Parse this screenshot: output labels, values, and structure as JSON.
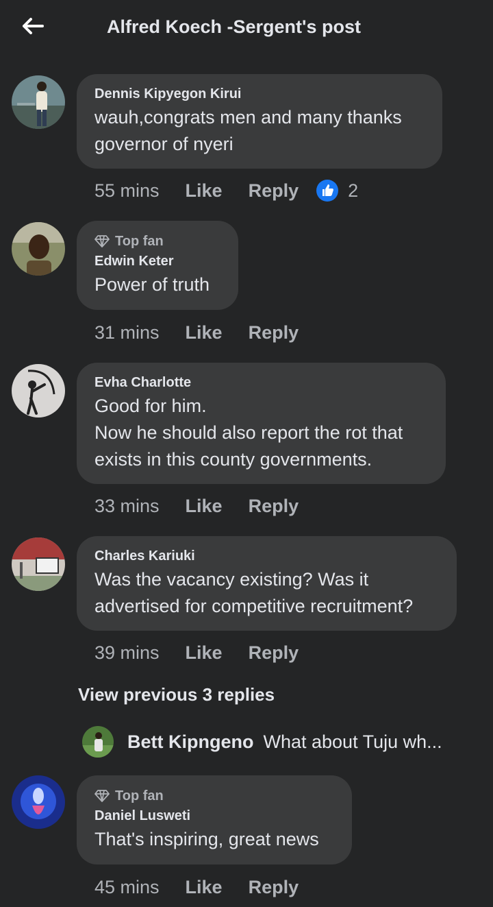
{
  "header": {
    "title": "Alfred Koech -Sergent's post",
    "back_icon": "arrow-left-icon"
  },
  "colors": {
    "background": "#242526",
    "bubble": "#3a3b3c",
    "text": "#e4e6eb",
    "muted": "#b0b3b8",
    "like_blue": "#1877f2"
  },
  "comments": [
    {
      "author": "Dennis Kipyegon Kirui",
      "text": "wauh,congrats men and many thanks\ngovernor of nyeri",
      "time": "55 mins",
      "like": "Like",
      "reply": "Reply",
      "reaction_count": "2"
    },
    {
      "top_fan": "Top fan",
      "author": "Edwin Keter",
      "text": "Power of truth",
      "time": "31 mins",
      "like": "Like",
      "reply": "Reply"
    },
    {
      "author": "Evha Charlotte",
      "text": "Good for him.\nNow he should also report the rot that\nexists in this county governments.",
      "time": "33 mins",
      "like": "Like",
      "reply": "Reply"
    },
    {
      "author": "Charles Kariuki",
      "text": "Was the vacancy existing? Was it\nadvertised for competitive recruitment?",
      "time": "39 mins",
      "like": "Like",
      "reply": "Reply"
    },
    {
      "top_fan": "Top fan",
      "author": "Daniel Lusweti",
      "text": "That's inspiring, great news",
      "time": "45 mins",
      "like": "Like",
      "reply": "Reply"
    }
  ],
  "replies_thread": {
    "view_previous": "View previous 3 replies",
    "preview_author": "Bett Kipngeno",
    "preview_text": "What about Tuju wh..."
  }
}
